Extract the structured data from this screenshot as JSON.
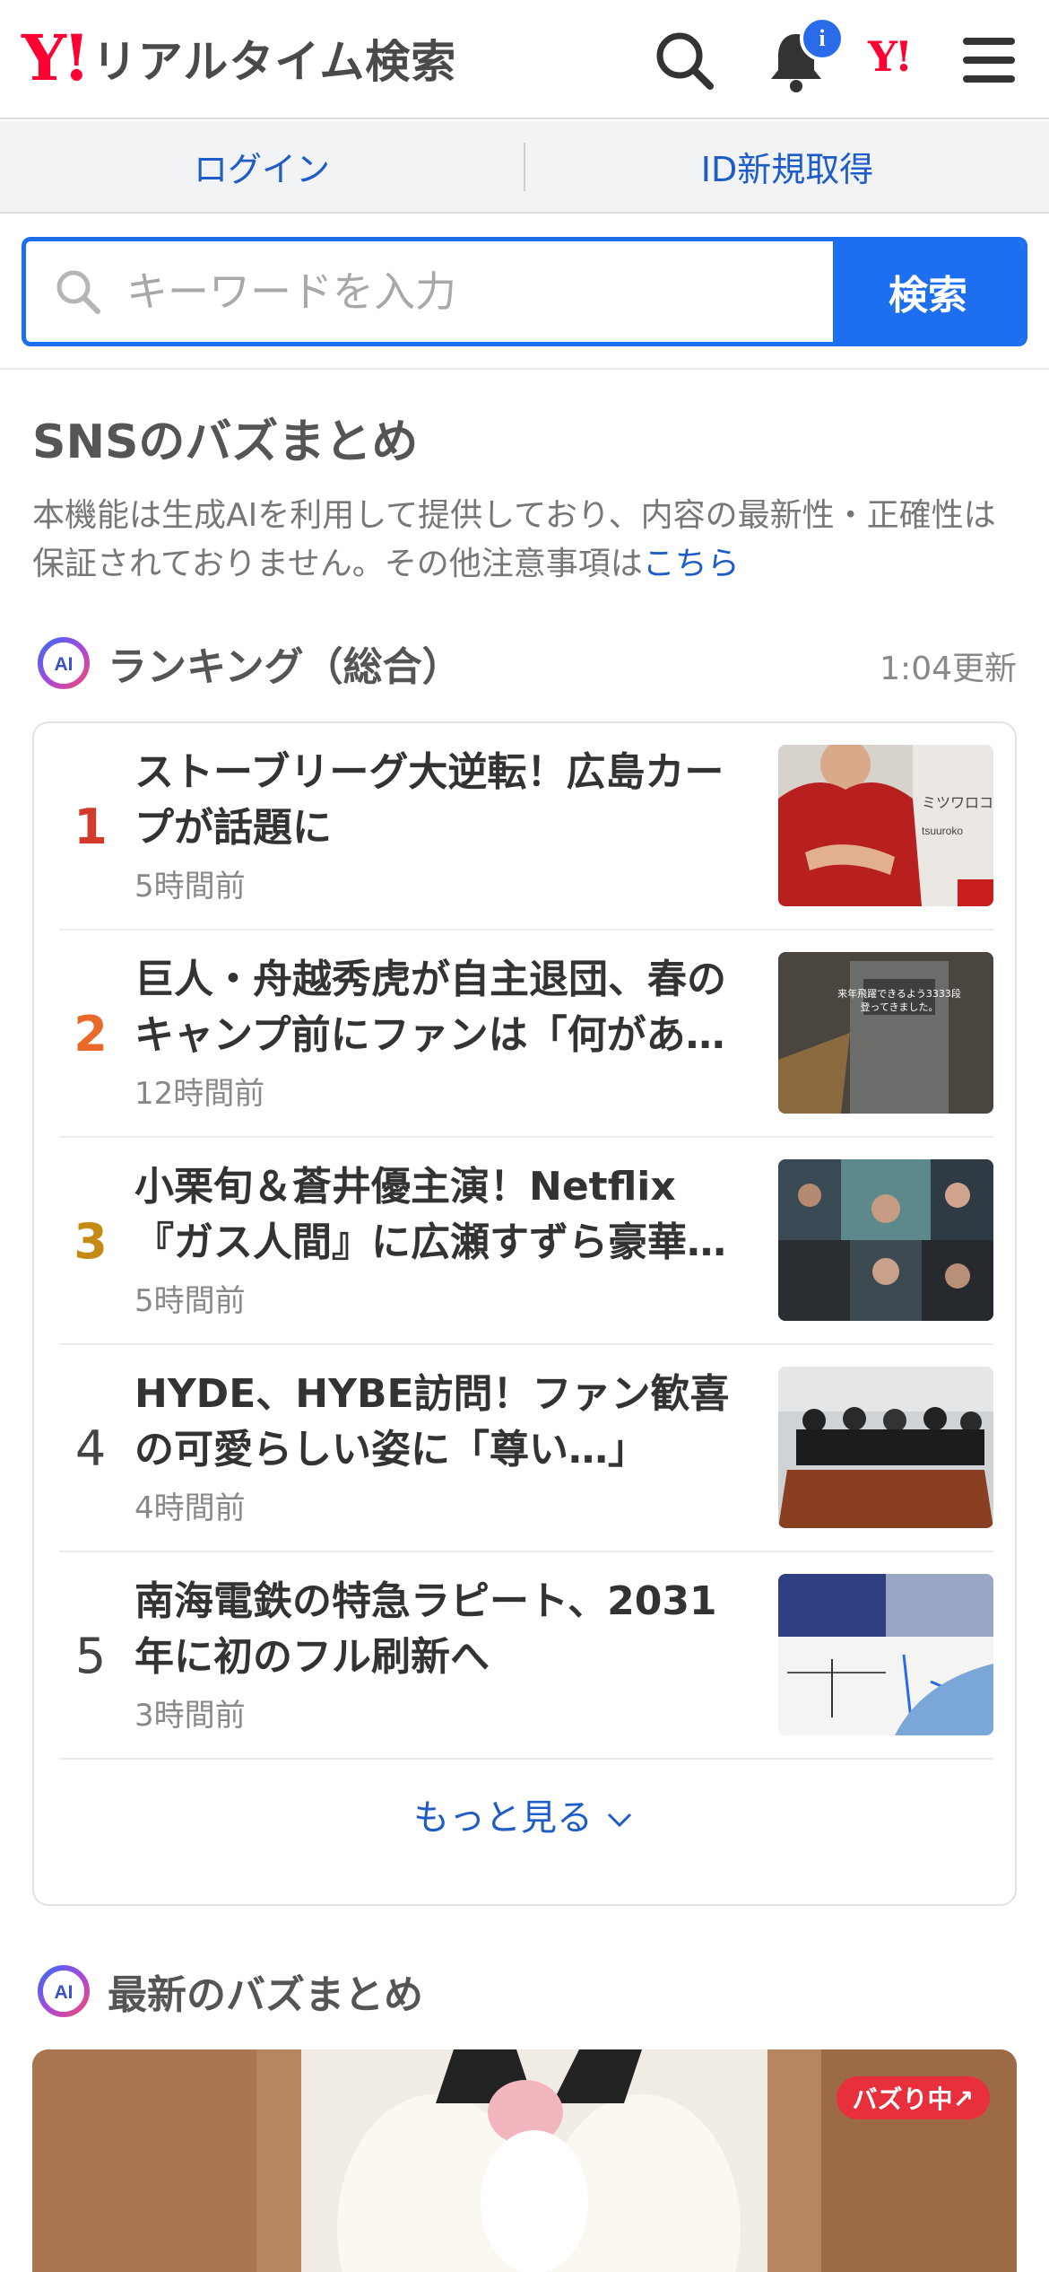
{
  "header": {
    "logo_mark": "Y!",
    "logo_text": "リアルタイム検索",
    "notification_badge": "i",
    "yahoo_mark": "Y!"
  },
  "auth": {
    "login": "ログイン",
    "signup": "ID新規取得"
  },
  "search": {
    "placeholder": "キーワードを入力",
    "button": "検索"
  },
  "buzz_summary": {
    "title": "SNSのバズまとめ",
    "notice": "本機能は生成AIを利用して提供しており、内容の最新性・正確性は保証されておりません。その他注意事項は",
    "notice_link": "こちら"
  },
  "ranking": {
    "heading": "ランキング（総合）",
    "updated": "1:04更新",
    "ai_label": "AI",
    "items": [
      {
        "rank": "1",
        "title": "ストーブリーグ大逆転！広島カープが話題に",
        "time": "5時間前",
        "color": "#d23a2a"
      },
      {
        "rank": "2",
        "title": "巨人・舟越秀虎が自主退団、春のキャンプ前にファンは「何があ…",
        "time": "12時間前",
        "color": "#e8692a"
      },
      {
        "rank": "3",
        "title": "小栗旬＆蒼井優主演！Netflix『ガス人間』に広瀬すずら豪華…",
        "time": "5時間前",
        "color": "#c48a14"
      },
      {
        "rank": "4",
        "title": "HYDE、HYBE訪問！ファン歓喜の可愛らしい姿に「尊い…」",
        "time": "4時間前",
        "color": "#444444"
      },
      {
        "rank": "5",
        "title": "南海電鉄の特急ラピート、2031年に初のフル刷新へ",
        "time": "3時間前",
        "color": "#444444"
      }
    ],
    "more": "もっと見る"
  },
  "latest": {
    "heading": "最新のバズまとめ",
    "ai_label": "AI",
    "badge": "バズり中↗"
  }
}
